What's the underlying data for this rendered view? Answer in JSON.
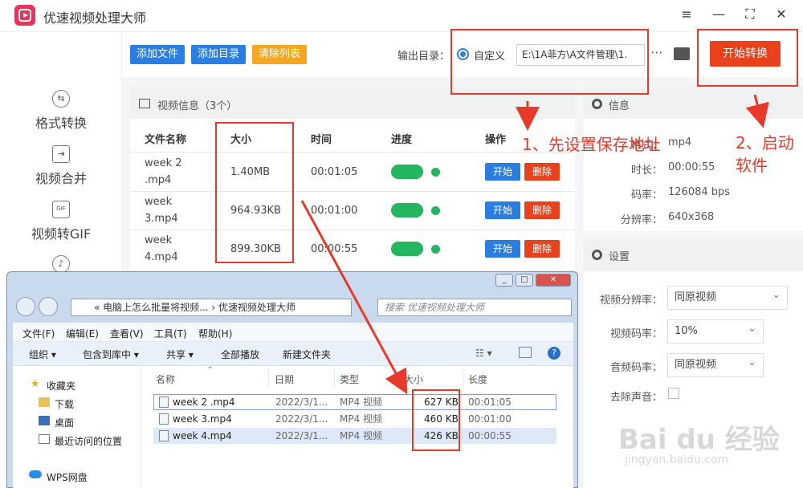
{
  "app": {
    "title": "优速视频处理大师",
    "colors": {
      "accent": "#2a7de1",
      "danger": "#e8411c",
      "success": "#23b560",
      "annotation": "#e83a2a"
    },
    "window_controls": [
      "menu-icon",
      "minimize-icon",
      "maximize-icon",
      "close-icon"
    ]
  },
  "sidebar": {
    "items": [
      {
        "label": "格式转换",
        "icon": "convert-icon"
      },
      {
        "label": "视频合并",
        "icon": "merge-icon"
      },
      {
        "label": "视频转GIF",
        "icon": "gif-icon"
      }
    ]
  },
  "toolbar": {
    "add_file": "添加文件",
    "add_dir": "添加目录",
    "clear_list": "清除列表",
    "output_label": "输出目录：",
    "custom_label": "自定义",
    "output_path": "E:\\1A菲方\\A文件管理\\1.",
    "more": "···",
    "start": "开始转换"
  },
  "video_panel": {
    "title": "视频信息（3个）",
    "headers": [
      "文件名称",
      "大小",
      "时间",
      "进度",
      "操作"
    ],
    "rows": [
      {
        "name": "week 2 .mp4",
        "size": "1.40MB",
        "time": "00:01:05"
      },
      {
        "name": "week 3.mp4",
        "size": "964.93KB",
        "time": "00:01:00"
      },
      {
        "name": "week 4.mp4",
        "size": "899.30KB",
        "time": "00:00:55"
      }
    ],
    "start_label": "开始",
    "delete_label": "删除"
  },
  "info_panel": {
    "title": "信息",
    "fields": [
      {
        "label": "格式：",
        "value": "mp4"
      },
      {
        "label": "时长：",
        "value": "00:00:55"
      },
      {
        "label": "码率：",
        "value": "126084 bps"
      },
      {
        "label": "分辨率：",
        "value": "640x368"
      }
    ]
  },
  "settings_panel": {
    "title": "设置",
    "resolution_label": "视频分辨率：",
    "resolution_value": "同原视频",
    "vbitrate_label": "视频码率：",
    "vbitrate_value": "10%",
    "abitrate_label": "音频码率：",
    "abitrate_value": "同原视频",
    "mute_label": "去除声音："
  },
  "annotations": {
    "step1": "1、先设置保存地址",
    "step2_line1": "2、启动",
    "step2_line2": "软件"
  },
  "explorer": {
    "address": "«  电脑上怎么批量将视频...  ›  优速视频处理大师",
    "search_placeholder": "搜索 优速视频处理大师",
    "menu": [
      "文件(F)",
      "编辑(E)",
      "查看(V)",
      "工具(T)",
      "帮助(H)"
    ],
    "commands": [
      "组织 ▾",
      "包含到库中 ▾",
      "共享 ▾",
      "全部播放",
      "新建文件夹"
    ],
    "nav": [
      "收藏夹",
      "下载",
      "桌面",
      "最近访问的位置",
      "WPS网盘"
    ],
    "columns": [
      "名称",
      "日期",
      "类型",
      "大小",
      "长度"
    ],
    "files": [
      {
        "name": "week 2 .mp4",
        "date": "2022/3/1...",
        "type": "MP4 视频",
        "size": "627 KB",
        "length": "00:01:05"
      },
      {
        "name": "week 3.mp4",
        "date": "2022/3/1...",
        "type": "MP4 视频",
        "size": "460 KB",
        "length": "00:01:00"
      },
      {
        "name": "week 4.mp4",
        "date": "2022/3/1...",
        "type": "MP4 视频",
        "size": "426 KB",
        "length": "00:00:55"
      }
    ]
  },
  "watermark": {
    "logo": "Bai du 经验",
    "url": "jingyan.baidu.com"
  }
}
